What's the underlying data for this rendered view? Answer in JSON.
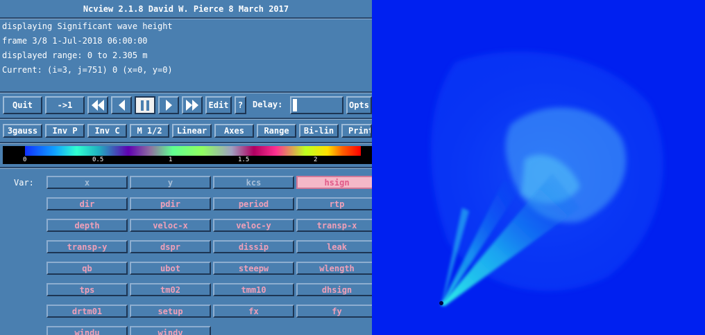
{
  "window": {
    "title": "Ncview 2.1.8 David W. Pierce  8 March 2017"
  },
  "info": {
    "displaying": "displaying Significant wave height",
    "frame": "frame 3/8 1-Jul-2018 06:00:00",
    "range": "displayed range: 0 to 2.305 m",
    "current": "Current: (i=3, j=751) 0 (x=0, y=0)"
  },
  "controls": {
    "quit": "Quit",
    "first": "->1",
    "edit": "Edit",
    "help": "?",
    "delay_label": "Delay:",
    "opts": "Opts"
  },
  "options": {
    "gauss": "3gauss",
    "invp": "Inv P",
    "invc": "Inv C",
    "mag": "M 1/2",
    "linear": "Linear",
    "axes": "Axes",
    "range": "Range",
    "bilin": "Bi-lin",
    "print": "Print"
  },
  "colorbar": {
    "labels": [
      "0",
      "0.5",
      "1",
      "1.5",
      "2"
    ]
  },
  "vars": {
    "label": "Var:",
    "items": [
      "x",
      "y",
      "kcs",
      "hsign",
      "dir",
      "pdir",
      "period",
      "rtp",
      "depth",
      "veloc-x",
      "veloc-y",
      "transp-x",
      "transp-y",
      "dspr",
      "dissip",
      "leak",
      "qb",
      "ubot",
      "steepw",
      "wlength",
      "tps",
      "tm02",
      "tmm10",
      "dhsign",
      "drtm01",
      "setup",
      "fx",
      "fy",
      "windu",
      "windv"
    ],
    "selected": "hsign"
  },
  "colors": {
    "panel": "#4a7fb0",
    "image_background": "#0020f0",
    "var_text": "#f0a0b8",
    "selected_var": "#f5b8c8"
  }
}
